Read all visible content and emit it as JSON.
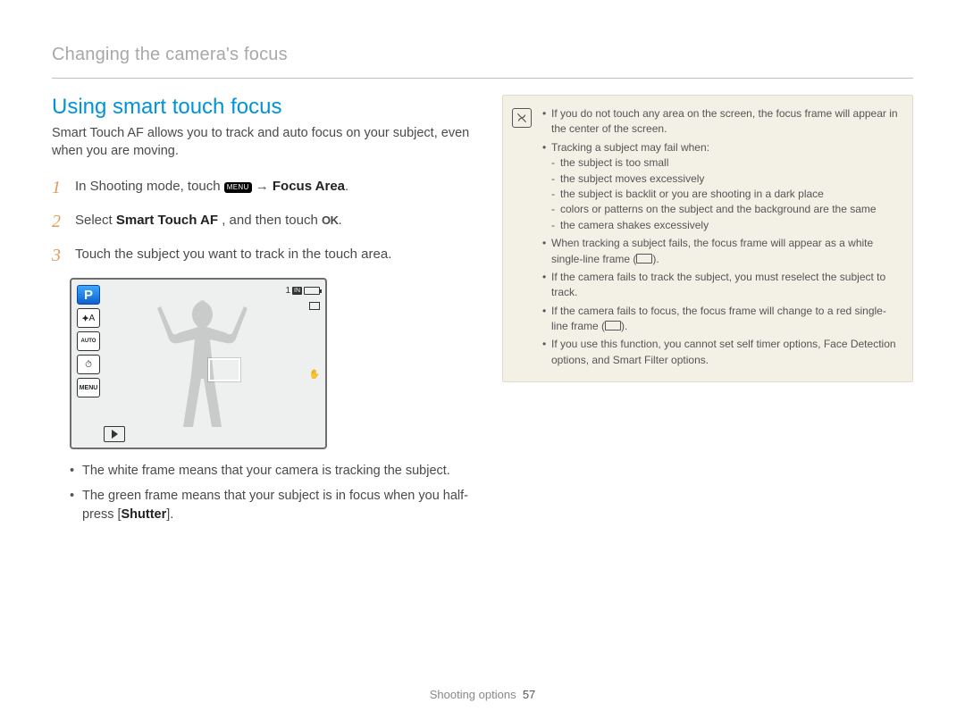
{
  "subhead": "Changing the camera's focus",
  "title": "Using smart touch focus",
  "intro": "Smart Touch AF allows you to track and auto focus on your subject, even when you are moving.",
  "steps": {
    "s1_a": "In Shooting mode, touch ",
    "s1_menu_badge": "MENU",
    "s1_arrow": " → ",
    "s1_b": "Focus Area",
    "s1_c": ".",
    "s2_a": "Select ",
    "s2_bold": "Smart Touch AF",
    "s2_b": ", and then touch ",
    "s2_ok": "OK",
    "s2_c": ".",
    "s3": "Touch the subject you want to track in the touch area."
  },
  "nums": {
    "n1": "1",
    "n2": "2",
    "n3": "3"
  },
  "screen": {
    "mode_letter": "P",
    "flash_label": "⯌A",
    "auto_label": "AUTO",
    "timer_label": "⏱",
    "menu_label": "MENU",
    "count": "1",
    "storage": "IN"
  },
  "left_bullets": {
    "b1": "The white frame means that your camera is tracking the subject.",
    "b2_a": "The green frame means that your subject is in focus when you half-press [",
    "b2_bold": "Shutter",
    "b2_b": "]."
  },
  "note": {
    "n1": "If you do not touch any area on the screen, the focus frame will appear in the center of the screen.",
    "n2": "Tracking a subject may fail when:",
    "n2subs": {
      "a": "the subject is too small",
      "b": "the subject moves excessively",
      "c": "the subject is backlit or you are shooting in a dark place",
      "d": "colors or patterns on the subject and the background are the same",
      "e": "the camera shakes excessively"
    },
    "n3_a": "When tracking a subject fails, the focus frame will appear as a white single-line frame (",
    "n3_b": ").",
    "n4": "If the camera fails to track the subject, you must reselect the subject to track.",
    "n5_a": "If the camera fails to focus, the focus frame will change to a red single-line frame (",
    "n5_b": ").",
    "n6": "If you use this function, you cannot set self timer options, Face Detection options, and Smart Filter options."
  },
  "footer": {
    "label": "Shooting options",
    "page": "57"
  }
}
